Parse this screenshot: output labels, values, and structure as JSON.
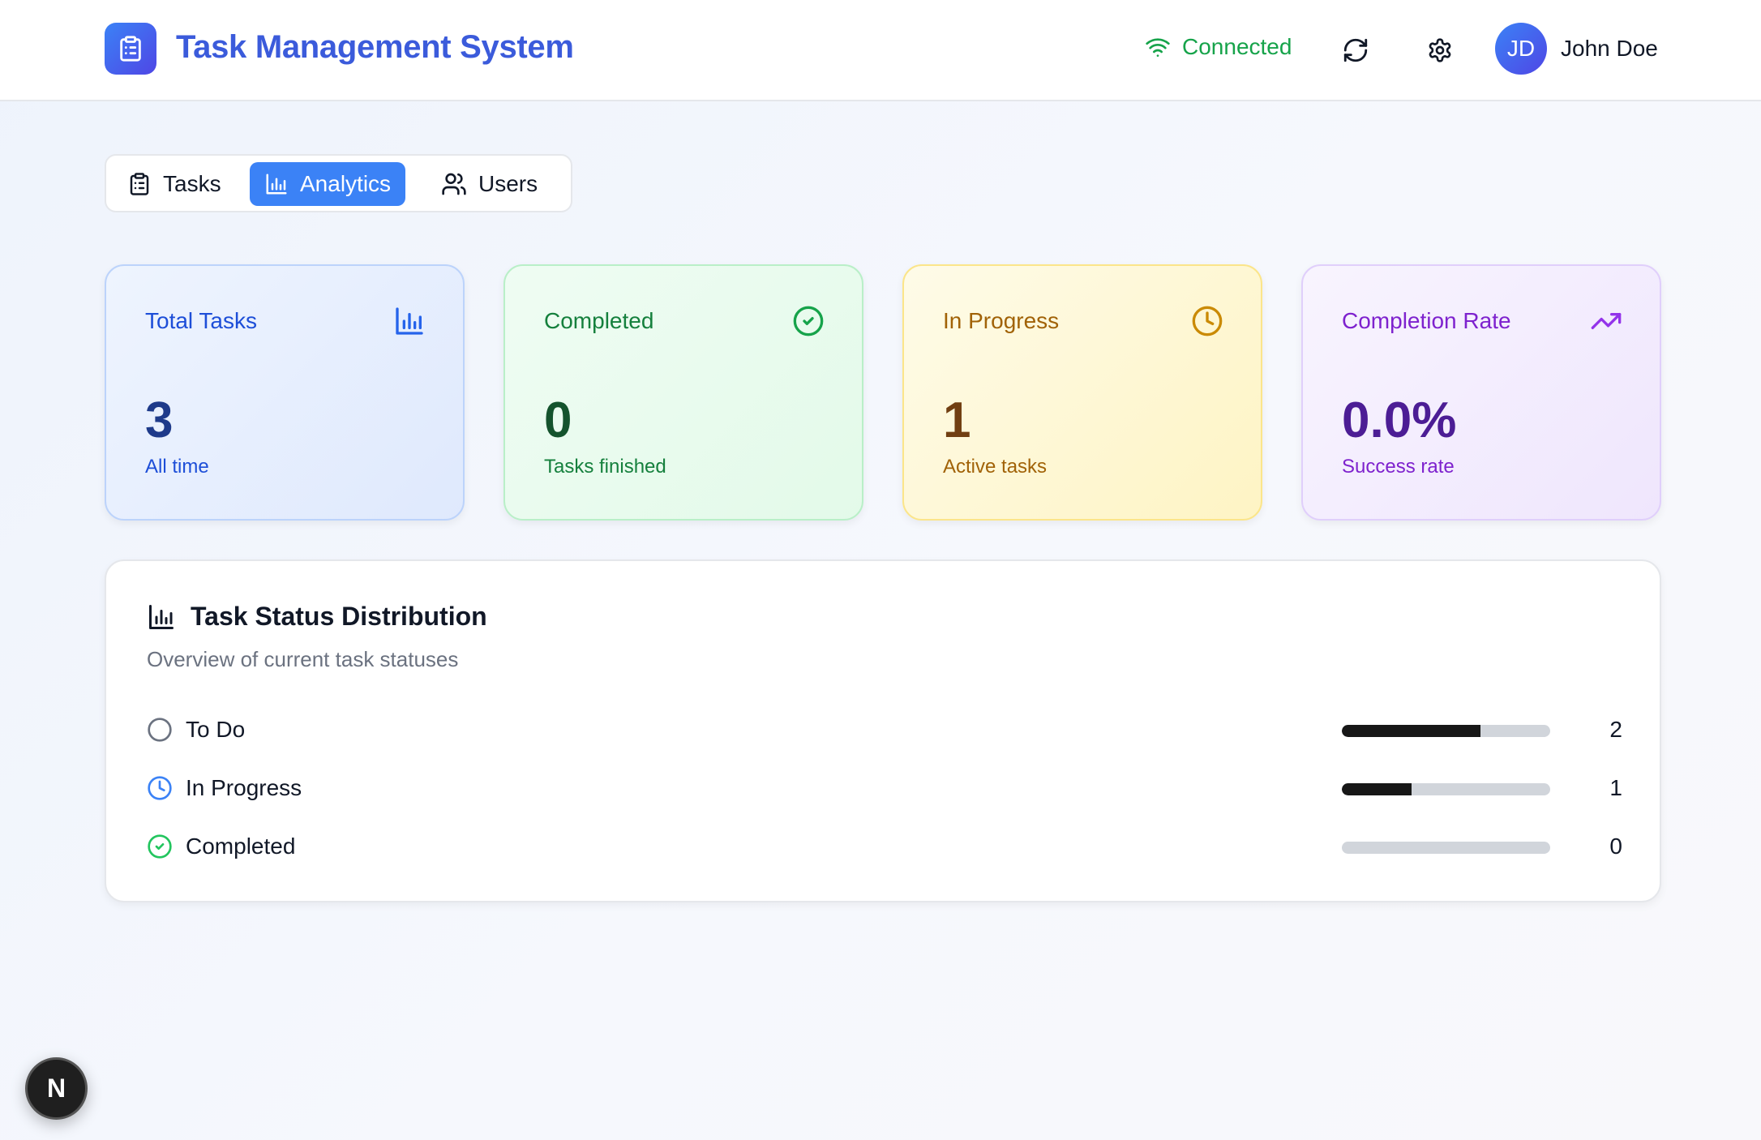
{
  "header": {
    "title": "Task Management System",
    "connection_status": "Connected",
    "user": {
      "initials": "JD",
      "name": "John Doe"
    }
  },
  "tabs": [
    {
      "label": "Tasks",
      "icon": "clipboard-icon",
      "active": false
    },
    {
      "label": "Analytics",
      "icon": "bar-chart-icon",
      "active": true
    },
    {
      "label": "Users",
      "icon": "users-icon",
      "active": false
    }
  ],
  "stats": [
    {
      "title": "Total Tasks",
      "value": "3",
      "subtitle": "All time",
      "icon": "bar-chart-icon",
      "color": "#1d4ed8"
    },
    {
      "title": "Completed",
      "value": "0",
      "subtitle": "Tasks finished",
      "icon": "check-circle-icon",
      "color": "#15803d"
    },
    {
      "title": "In Progress",
      "value": "1",
      "subtitle": "Active tasks",
      "icon": "clock-icon",
      "color": "#a16207"
    },
    {
      "title": "Completion Rate",
      "value": "0.0%",
      "subtitle": "Success rate",
      "icon": "trending-up-icon",
      "color": "#7e22ce"
    }
  ],
  "distribution": {
    "title": "Task Status Distribution",
    "subtitle": "Overview of current task statuses",
    "rows": [
      {
        "label": "To Do",
        "count": "2",
        "fraction": 0.667,
        "icon": "circle-icon",
        "color": "#6b7280"
      },
      {
        "label": "In Progress",
        "count": "1",
        "fraction": 0.333,
        "icon": "clock-icon",
        "color": "#3b82f6"
      },
      {
        "label": "Completed",
        "count": "0",
        "fraction": 0.0,
        "icon": "check-circle-icon",
        "color": "#22c55e"
      }
    ]
  },
  "badge": {
    "label": "N"
  }
}
